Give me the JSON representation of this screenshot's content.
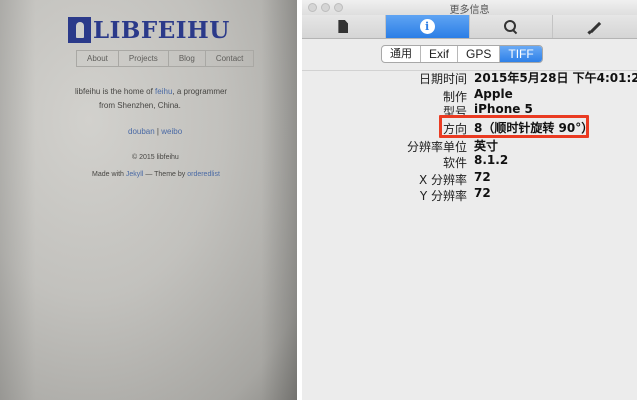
{
  "photo": {
    "logo_text": "LIBFEIHU",
    "nav": [
      "About",
      "Projects",
      "Blog",
      "Contact"
    ],
    "intro_prefix": "libfeihu is the home of ",
    "intro_link": "feihu",
    "intro_suffix": ", a programmer",
    "intro_line2": "from Shenzhen, China.",
    "social_douban": "douban",
    "social_sep": " | ",
    "social_weibo": "weibo",
    "copyright": "© 2015 libfeihu",
    "made_prefix": "Made with ",
    "made_jekyll": "Jekyll",
    "made_mid": " — Theme by ",
    "made_theme": "orderedlist"
  },
  "window": {
    "title": "更多信息",
    "toolbar_icons": [
      "document-icon",
      "info-icon",
      "search-icon",
      "pencil-icon"
    ],
    "active_toolbar": "info",
    "info_glyph": "i",
    "tabs": [
      "通用",
      "Exif",
      "GPS",
      "TIFF"
    ],
    "active_tab": "TIFF",
    "accent_color": "#2f7fe6",
    "highlight_color": "#ea3b22",
    "rows": [
      {
        "label": "日期时间",
        "value": "2015年5月28日 下午4:01:24"
      },
      {
        "label": "制作",
        "value": "Apple"
      },
      {
        "label": "型号",
        "value": "iPhone 5"
      },
      {
        "label": "方向",
        "value": "8（顺时针旋转 90°）"
      },
      {
        "label": "分辨率单位",
        "value": "英寸"
      },
      {
        "label": "软件",
        "value": "8.1.2"
      },
      {
        "label": "X 分辨率",
        "value": "72"
      },
      {
        "label": "Y 分辨率",
        "value": "72"
      }
    ]
  }
}
